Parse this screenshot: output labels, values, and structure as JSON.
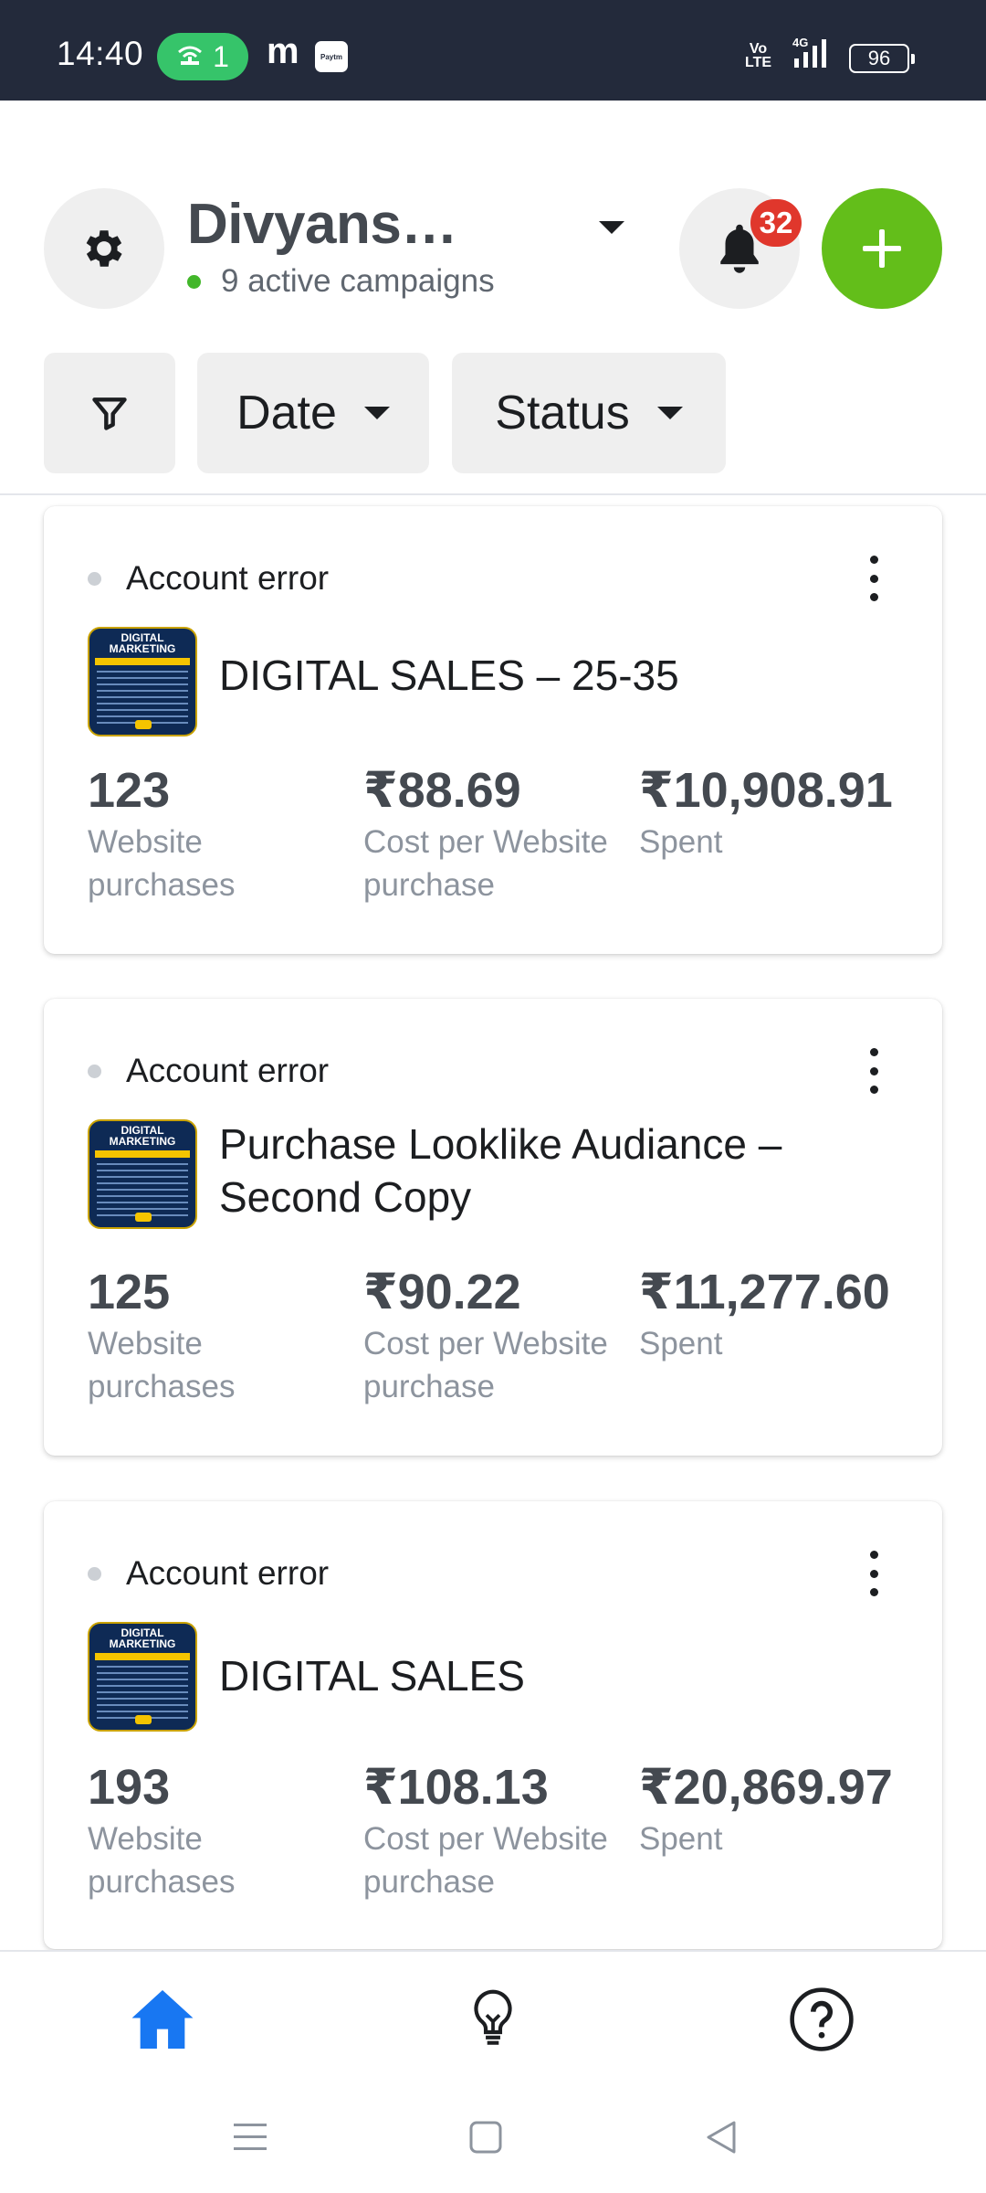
{
  "status_bar": {
    "time": "14:40",
    "hotspot_count": "1",
    "app_letter": "m",
    "paytm": "Paytm",
    "volte": "Vo\nLTE",
    "network": "4G",
    "battery": "96"
  },
  "header": {
    "account_name": "Divyans…",
    "active_campaigns": "9 active campaigns",
    "notification_count": "32",
    "accent_color": "#63be1a"
  },
  "filters": {
    "date_label": "Date",
    "status_label": "Status"
  },
  "campaigns": [
    {
      "status": "Account error",
      "title": "DIGITAL SALES – 25-35",
      "thumb_title": "DIGITAL MARKETING",
      "metrics": [
        {
          "value": "123",
          "label": "Website purchases"
        },
        {
          "value": "₹88.69",
          "label": "Cost per Website purchase"
        },
        {
          "value": "₹10,908.91",
          "label": "Spent"
        }
      ]
    },
    {
      "status": "Account error",
      "title": "Purchase Looklike Audiance – Second Copy",
      "thumb_title": "DIGITAL MARKETING",
      "metrics": [
        {
          "value": "125",
          "label": "Website purchases"
        },
        {
          "value": "₹90.22",
          "label": "Cost per Website purchase"
        },
        {
          "value": "₹11,277.60",
          "label": "Spent"
        }
      ]
    },
    {
      "status": "Account error",
      "title": "DIGITAL SALES",
      "thumb_title": "DIGITAL MARKETING",
      "metrics": [
        {
          "value": "193",
          "label": "Website purchases"
        },
        {
          "value": "₹108.13",
          "label": "Cost per Website purchase"
        },
        {
          "value": "₹20,869.97",
          "label": "Spent"
        }
      ]
    }
  ],
  "bottom_nav": {
    "items": [
      "home-icon",
      "lightbulb-icon",
      "help-icon"
    ],
    "active_color": "#1877f2"
  }
}
